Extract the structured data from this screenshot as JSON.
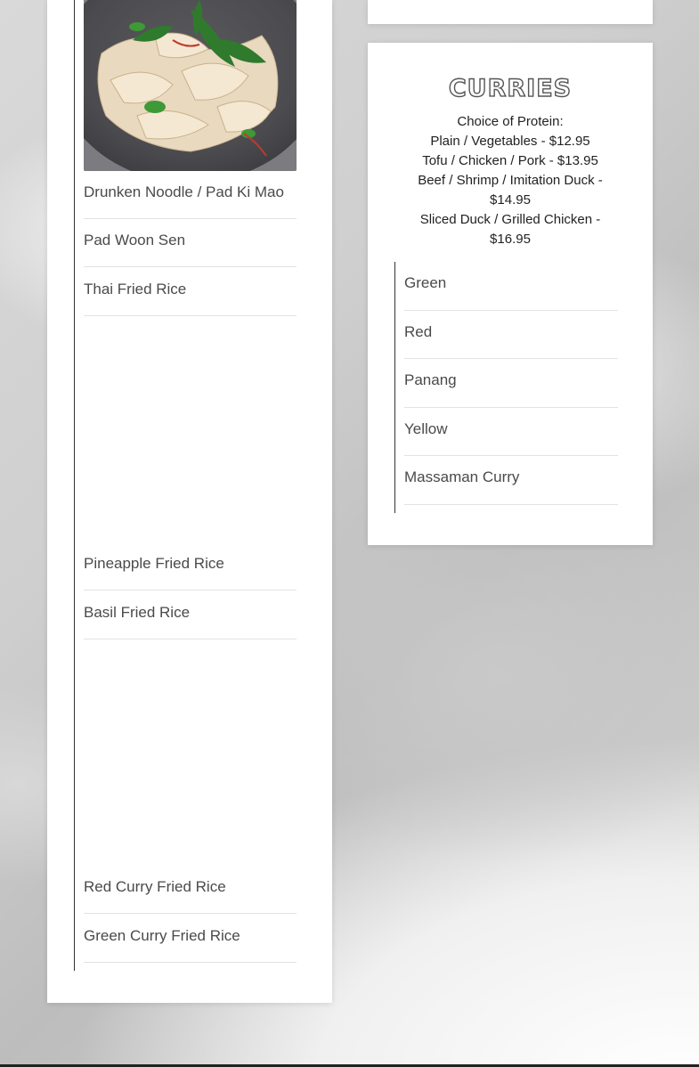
{
  "noodles_rice": {
    "photo": "drunken-noodle-photo",
    "items": [
      "Drunken Noodle / Pad Ki Mao",
      "Pad Woon Sen",
      "Thai Fried Rice",
      "Pineapple Fried Rice",
      "Basil Fried Rice",
      "Red Curry Fried Rice",
      "Green Curry Fried Rice"
    ]
  },
  "curries": {
    "title": "CURRIES",
    "protein_heading": "Choice of Protein:",
    "protein_options": [
      "Plain / Vegetables - $12.95",
      "Tofu / Chicken / Pork - $13.95",
      "Beef / Shrimp / Imitation Duck - $14.95",
      "Sliced Duck / Grilled Chicken - $16.95"
    ],
    "items": [
      "Green",
      "Red",
      "Panang",
      "Yellow",
      "Massaman Curry"
    ]
  },
  "colors": {
    "card": "#ffffff",
    "text": "#4a4a4a",
    "rule": "#333333",
    "divider": "#e3e3e3"
  }
}
